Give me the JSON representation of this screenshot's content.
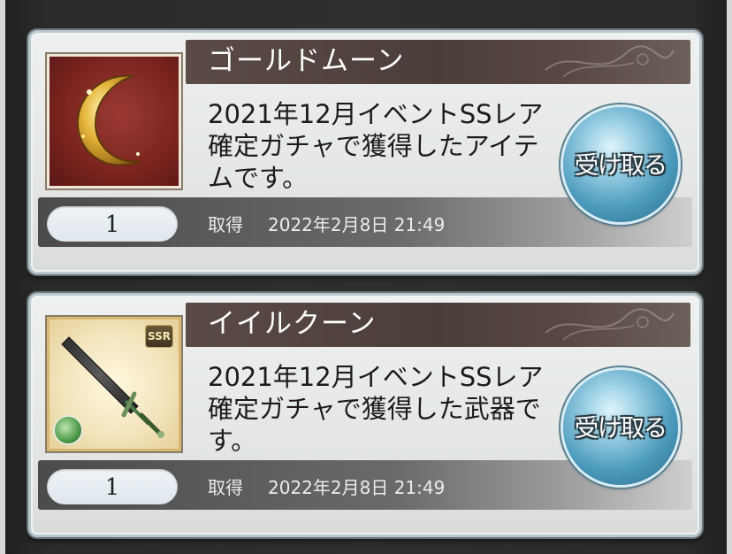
{
  "items": [
    {
      "name": "ゴールドムーン",
      "description": "2021年12月イベントSSレア確定ガチャで獲得したアイテムです。",
      "quantity": "1",
      "acquired_label": "取得",
      "acquired_date": "2022年2月8日  21:49",
      "receive_label": "受け取る",
      "thumbnail_icon": "gold-moon-icon"
    },
    {
      "name": "イイルクーン",
      "description": "2021年12月イベントSSレア確定ガチャで獲得した武器です。",
      "quantity": "1",
      "acquired_label": "取得",
      "acquired_date": "2022年2月8日  21:49",
      "receive_label": "受け取る",
      "thumbnail_icon": "sword-icon",
      "rarity_badge": "SSR",
      "element_icon": "wind-element-icon"
    }
  ],
  "colors": {
    "title_bar": "#4b3d39",
    "receive_button": "#4c9bbd",
    "moon_bg": "#7d2520",
    "sword_bg": "#f3e5bd"
  }
}
